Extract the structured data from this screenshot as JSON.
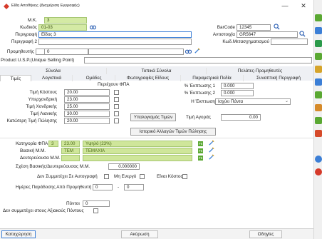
{
  "window": {
    "title": "Είδη Αποθήκης (Διαχείριση Εγγραφής)",
    "minimize": "—",
    "close": "✕"
  },
  "header": {
    "mk_label": "Μ.Κ.",
    "mk_value": "3",
    "code_label": "Κωδικός",
    "code_value": "01-03",
    "desc_label": "Περιγραφή",
    "desc_value": "Είδος 3",
    "desc2_label": "Περιγραφή 2",
    "desc2_value": "",
    "supplier_label": "Προμηθευτής",
    "supplier_value": "0",
    "usp_label": "Product U.S.P.(Unique Selling Point)",
    "usp_value": "",
    "barcode_label": "BarCode",
    "barcode_value": "12345",
    "match_label": "Αντιστοιχία",
    "match_value": "GR5647",
    "conv_label": "Κωδ.Μετασχηματισμού",
    "conv_value": ""
  },
  "tabs_row1": [
    "Σύνολα",
    "Τοπικά Σύνολα",
    "Πελάτες-Προμηθευτές"
  ],
  "tabs_row2": [
    "Τιμές",
    "Λογιστικά",
    "Ομάδες",
    "Φωτογραφίες Είδους",
    "Παραμετρικά Πεδία",
    "Συναπτική Περιγραφή"
  ],
  "prices": {
    "vat_included_label": "Περιέχουν ΦΠΑ",
    "cost_label": "Τιμή Κόστους",
    "cost_value": "20.00",
    "wholesale_label": "Υπερχονδρική",
    "wholesale_value": "23.00",
    "retail_wholesale_label": "Τιμή Χονδρικής",
    "retail_wholesale_value": "25.00",
    "retail_label": "Τιμή Λιανικής",
    "retail_value": "30.00",
    "lowest_label": "Κατώτερη Τιμή Πώλησης",
    "lowest_value": "20.00",
    "disc1_label": "% Έκπτωσης 1",
    "disc1_value": "0.000",
    "disc2_label": "% Έκπτωσης 2",
    "disc2_value": "0.000",
    "disc_label": "Η Έκπτωση",
    "disc_value": "Ισχύει Πάντα",
    "calc_button": "Υπολογισμός Τιμών",
    "buy_label": "Τιμή Αγοράς",
    "buy_value": "0.00",
    "history_button": "Ιστορικό Αλλαγών Τιμών Πώλησης"
  },
  "extra": {
    "vat_cat_label": "Κατηγορία ΦΠΑ",
    "vat_cat_code": "3",
    "vat_cat_rate": "23.00",
    "vat_cat_text": "Υψηλό (23%)",
    "main_mm_label": "Βασική Μ.Μ.",
    "main_mm_code": "TEM",
    "main_mm_text": "ΤΕΜΑΧΙΑ",
    "sec_mm_label": "Δευτερεύουσα Μ.Μ.",
    "sec_mm_code": "",
    "sec_mm_text": "",
    "relation_label": "Σχέση Βασικής/Δευτερεύουσας Μ.Μ.",
    "relation_value": "0.000000",
    "f6_badge": "F6",
    "no_order_label": "Δεν Συμμετέχει Σε Αυτογραφή",
    "inactive_label": "Μη Ενεργό",
    "cost_type_label": "Είναι Κόστος",
    "delivery_label": "Ημέρες Παράδοσης Από Προμηθευτή",
    "delivery_from": "0",
    "delivery_dash": "-",
    "delivery_to": "0",
    "points_label": "Πόντοι",
    "points_value": "0",
    "no_value_label": "Δεν συμμετέχει στους Αξιακούς Πόντους"
  },
  "footer": {
    "save": "Καταχώρηση",
    "cancel": "Ακύρωση",
    "help": "Οδηγίες"
  },
  "colors": {
    "green": "#d4eaa4",
    "accent": "#3c7fd6",
    "side_green": "#5aa832"
  }
}
